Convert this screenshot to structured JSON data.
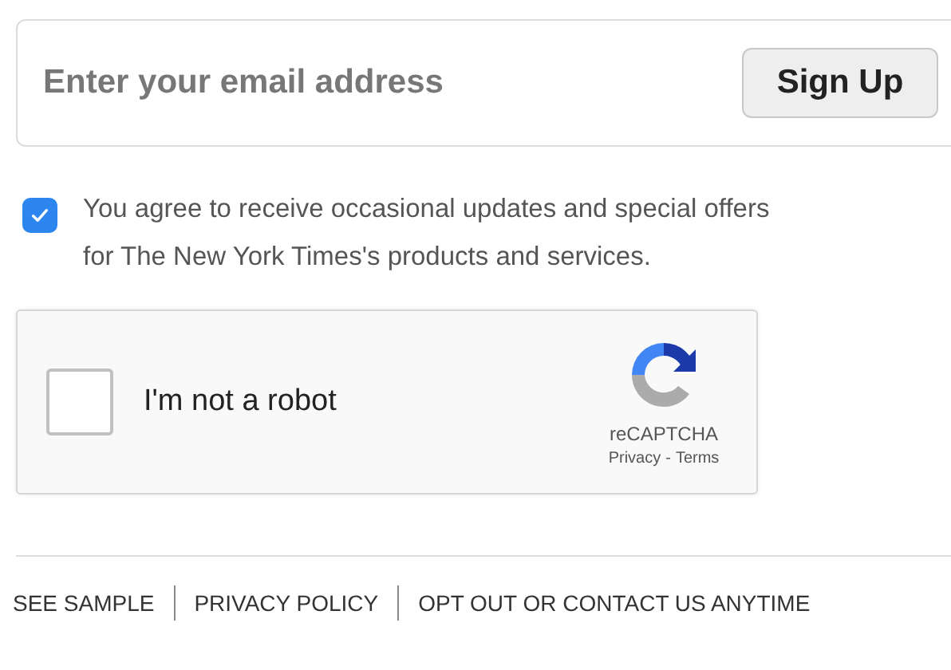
{
  "signup": {
    "email_field": {
      "placeholder": "Enter your email address"
    },
    "button": "Sign Up"
  },
  "consent": {
    "checked": true,
    "lines": [
      "You agree to receive occasional updates and special offers",
      "for The New York Times's products and services."
    ]
  },
  "captcha": {
    "checked": false,
    "label": "I'm not a robot",
    "brand": "reCAPTCHA",
    "links": [
      "Privacy",
      "-",
      "Terms"
    ]
  },
  "footer_links": [
    "SEE SAMPLE",
    "PRIVACY POLICY",
    "OPT OUT OR CONTACT US ANYTIME"
  ]
}
